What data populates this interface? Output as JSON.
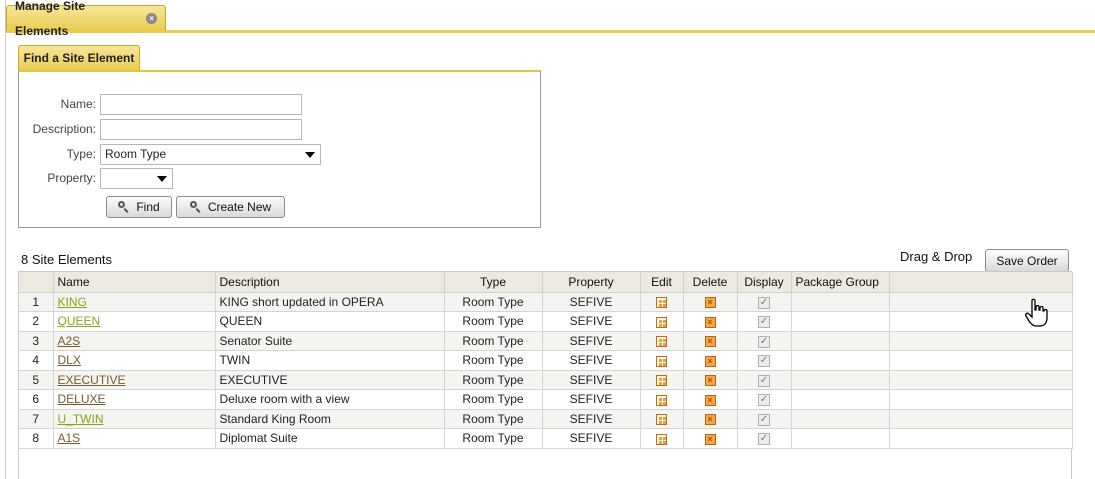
{
  "tab": {
    "title": "Manage Site Elements",
    "close_icon": "close-circle-icon"
  },
  "find": {
    "tab_label": "Find a Site Element",
    "name_label": "Name:",
    "name_value": "",
    "description_label": "Description:",
    "description_value": "",
    "type_label": "Type:",
    "type_selected": "Room Type",
    "property_label": "Property:",
    "property_selected": "",
    "find_button": "Find",
    "create_button": "Create New",
    "button_icon": "magnifier-icon"
  },
  "toolbar": {
    "count_label": "8 Site Elements",
    "drag_drop_label": "Drag & Drop",
    "save_order_label": "Save Order"
  },
  "table": {
    "headers": [
      "",
      "Name",
      "Description",
      "Type",
      "Property",
      "Edit",
      "Delete",
      "Display",
      "Package Group",
      ""
    ],
    "rows": [
      {
        "num": "1",
        "name": "KING",
        "description": "KING short updated in OPERA",
        "type": "Room Type",
        "property": "SEFIVE"
      },
      {
        "num": "2",
        "name": "QUEEN",
        "description": "QUEEN",
        "type": "Room Type",
        "property": "SEFIVE"
      },
      {
        "num": "3",
        "name": "A2S",
        "description": "Senator Suite",
        "type": "Room Type",
        "property": "SEFIVE"
      },
      {
        "num": "4",
        "name": "DLX",
        "description": "TWIN",
        "type": "Room Type",
        "property": "SEFIVE"
      },
      {
        "num": "5",
        "name": "EXECUTIVE",
        "description": "EXECUTIVE",
        "type": "Room Type",
        "property": "SEFIVE"
      },
      {
        "num": "6",
        "name": "DELUXE",
        "description": "Deluxe room with a view",
        "type": "Room Type",
        "property": "SEFIVE"
      },
      {
        "num": "7",
        "name": "U_TWIN",
        "description": "Standard King Room",
        "type": "Room Type",
        "property": "SEFIVE"
      },
      {
        "num": "8",
        "name": "A1S",
        "description": "Diplomat Suite",
        "type": "Room Type",
        "property": "SEFIVE"
      }
    ],
    "link_colors": [
      "#8aa318",
      "#8aa318",
      "#7a5a2a",
      "#7a5a2a",
      "#7a5a2a",
      "#7a5a2a",
      "#8aa318",
      "#7a5a2a"
    ],
    "edit_icon": "grid-edit-icon",
    "delete_icon": "delete-x-icon",
    "display_icon": "checkbox-checked-icon"
  },
  "colors": {
    "accent": "#e9cd4f",
    "header_bg": "#ebe9e0"
  }
}
